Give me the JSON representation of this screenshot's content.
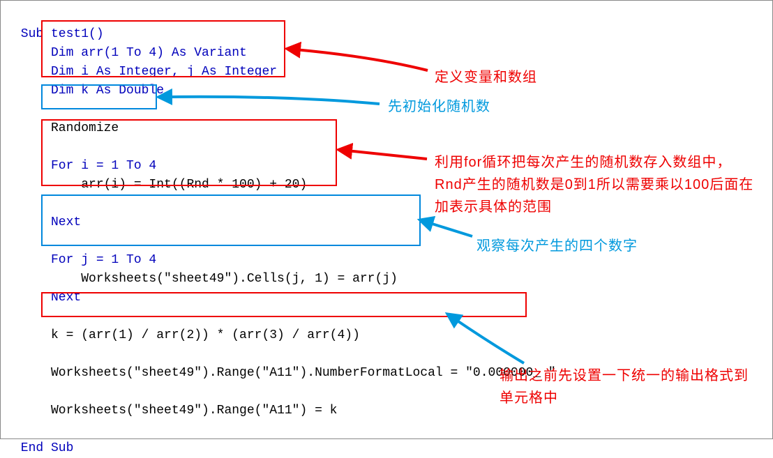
{
  "code": {
    "l1": " Sub test1()",
    "l2": "     Dim arr(1 To 4) As Variant",
    "l3": "     Dim i As Integer, j As Integer",
    "l4": "     Dim k As Double",
    "l5": "",
    "l6": "     Randomize",
    "l7": "",
    "l8": "     For i = 1 To 4",
    "l9": "         arr(i) = Int((Rnd * 100) + 20)",
    "l10": "",
    "l11": "     Next",
    "l12": "",
    "l13": "     For j = 1 To 4",
    "l14": "         Worksheets(\"sheet49\").Cells(j, 1) = arr(j)",
    "l15": "     Next",
    "l16": "",
    "l17": "     k = (arr(1) / arr(2)) * (arr(3) / arr(4))",
    "l18": "",
    "l19": "     Worksheets(\"sheet49\").Range(\"A11\").NumberFormatLocal = \"0.000000_ \"",
    "l20": "",
    "l21": "     Worksheets(\"sheet49\").Range(\"A11\") = k",
    "l22": "",
    "l23": " End Sub"
  },
  "annotations": {
    "a1": "定义变量和数组",
    "a2": "先初始化随机数",
    "a3": "利用for循环把每次产生的随机数存入数组中，Rnd产生的随机数是0到1所以需要乘以100后面在加表示具体的范围",
    "a4": "观察每次产生的四个数字",
    "a5": "输出之前先设置一下统一的输出格式到单元格中"
  },
  "colors": {
    "red": "#ee0000",
    "blue": "#0099dd"
  }
}
